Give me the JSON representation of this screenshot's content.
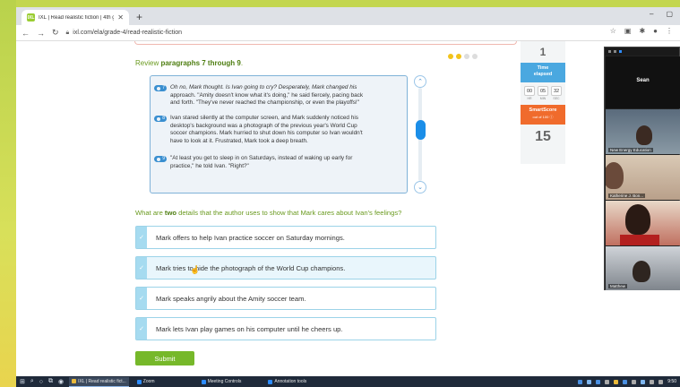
{
  "browser": {
    "tab_title": "IXL | Read realistic fiction | 4th g",
    "tab_favicon": "IXL",
    "url": "ixl.com/ela/grade-4/read-realistic-fiction"
  },
  "review": {
    "prefix": "Review ",
    "bold": "paragraphs 7 through 9",
    "suffix": "."
  },
  "paragraphs": [
    {
      "num": "7",
      "lines": [
        "Oh no, Mark thought. Is Ivan going to cry? Desperately, Mark changed his",
        "approach. \"Amity doesn't know what it's doing,\" he said fiercely, pacing back",
        "and forth. \"They've never reached the championship, or even the playoffs!\""
      ]
    },
    {
      "num": "8",
      "lines": [
        "Ivan stared silently at the computer screen, and Mark suddenly noticed his",
        "desktop's background was a photograph of the previous year's World Cup",
        "soccer champions. Mark hurried to shut down his computer so Ivan wouldn't",
        "have to look at it. Frustrated, Mark took a deep breath."
      ]
    },
    {
      "num": "9",
      "lines": [
        "\"At least you get to sleep in on Saturdays, instead of waking up early for",
        "practice,\" he told Ivan. \"Right?\""
      ]
    }
  ],
  "question": {
    "prefix": "What are ",
    "bold": "two",
    "suffix": " details that the author uses to show that Mark cares about Ivan's feelings?"
  },
  "choices": [
    "Mark offers to help Ivan practice soccer on Saturday mornings.",
    "Mark tries to hide the photograph of the World Cup champions.",
    "Mark speaks angrily about the Amity soccer team.",
    "Mark lets Ivan play games on his computer until he cheers up."
  ],
  "submit_label": "Submit",
  "stats": {
    "question_number": "1",
    "time_label_1": "Time",
    "time_label_2": "elapsed",
    "hr": "00",
    "min": "05",
    "sec": "32",
    "hr_unit": "HR",
    "min_unit": "MIN",
    "sec_unit": "SEC",
    "smartscore_label": "SmartScore",
    "smartscore_sub": "out of 100",
    "smartscore_value": "15"
  },
  "zoom": {
    "tiles": [
      {
        "name": "Sean"
      },
      {
        "name": "New Energy Education"
      },
      {
        "name": "Katherine J. Bon..."
      },
      {
        "name": ""
      },
      {
        "name": "Matthew"
      }
    ]
  },
  "taskbar": {
    "apps": [
      {
        "label": "IXL | Read realistic fict..."
      },
      {
        "label": "Zoom"
      },
      {
        "label": "Meeting Controls"
      },
      {
        "label": "Annotation tools"
      }
    ],
    "clock": "9:50"
  },
  "colors": {
    "ixl_green": "#76b82a",
    "ixl_blue": "#4aa8e0",
    "smartscore_orange": "#f06b2c",
    "dot_active": "#f2c31b"
  }
}
